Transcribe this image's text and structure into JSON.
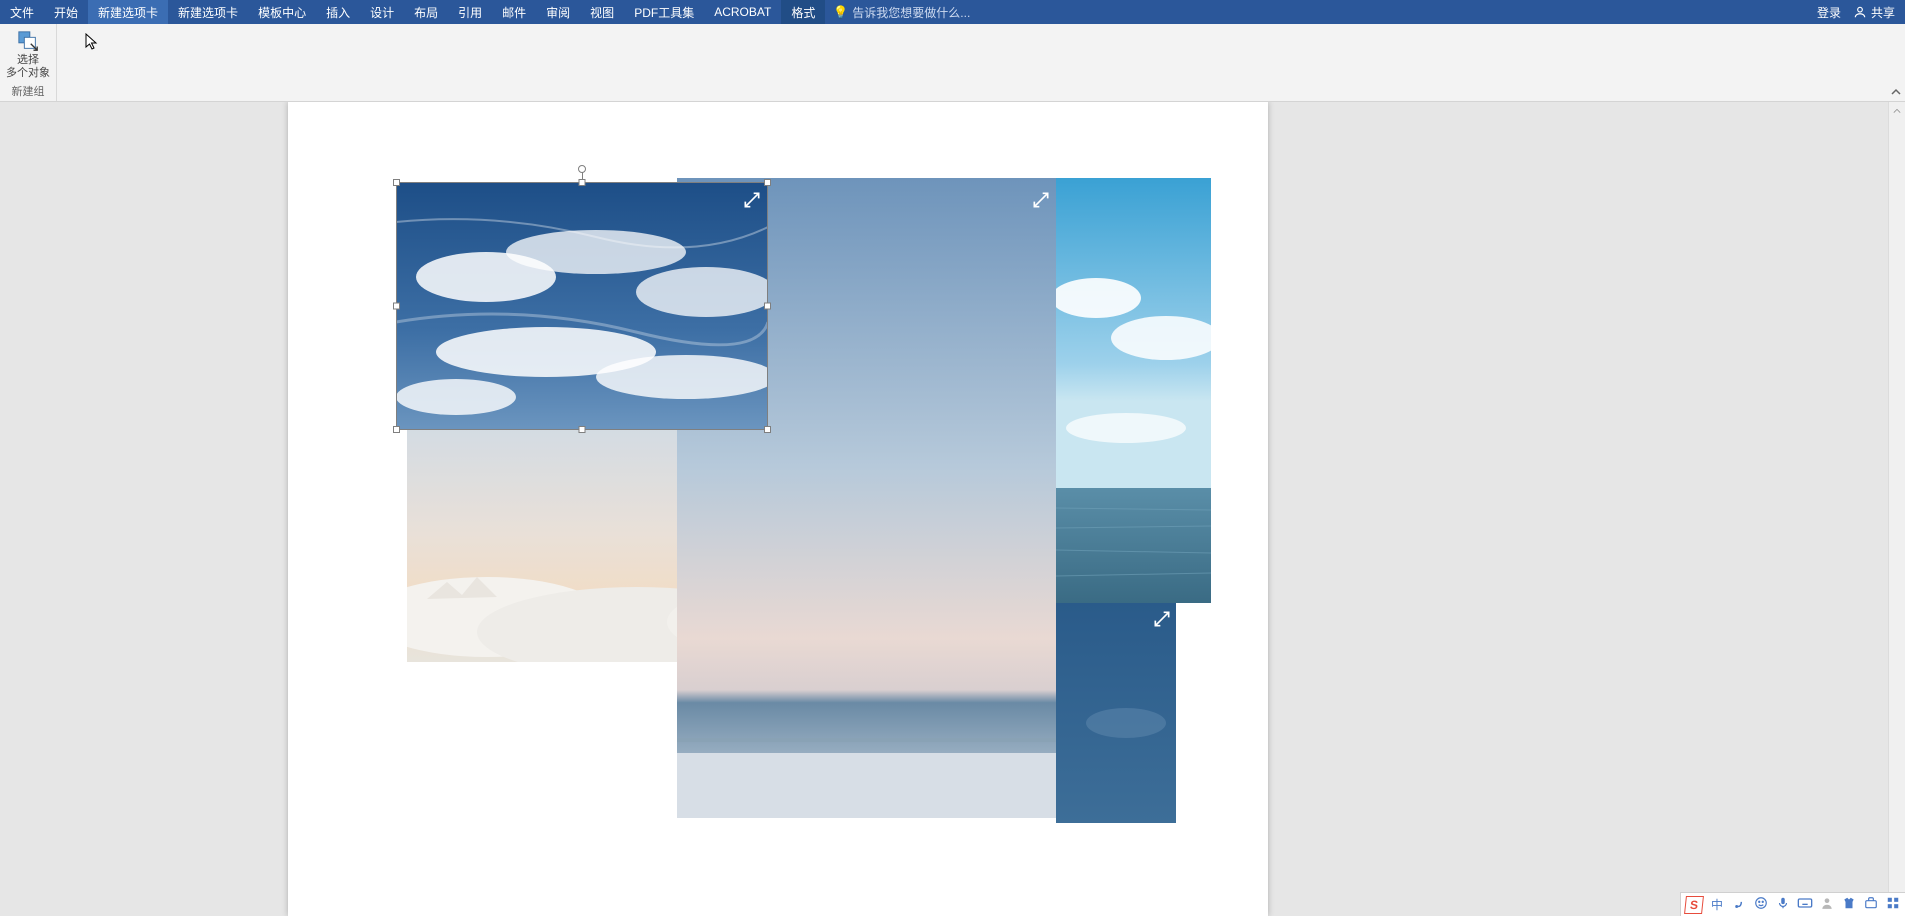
{
  "ribbon": {
    "tabs": [
      {
        "id": "file",
        "label": "文件"
      },
      {
        "id": "home",
        "label": "开始"
      },
      {
        "id": "newtab1",
        "label": "新建选项卡",
        "active": true
      },
      {
        "id": "newtab2",
        "label": "新建选项卡"
      },
      {
        "id": "templates",
        "label": "模板中心"
      },
      {
        "id": "insert",
        "label": "插入"
      },
      {
        "id": "design",
        "label": "设计"
      },
      {
        "id": "layout",
        "label": "布局"
      },
      {
        "id": "references",
        "label": "引用"
      },
      {
        "id": "mailings",
        "label": "邮件"
      },
      {
        "id": "review",
        "label": "审阅"
      },
      {
        "id": "view",
        "label": "视图"
      },
      {
        "id": "pdf",
        "label": "PDF工具集"
      },
      {
        "id": "acrobat",
        "label": "ACROBAT"
      },
      {
        "id": "format",
        "label": "格式",
        "contextual": true
      }
    ],
    "tell_me_placeholder": "告诉我您想要做什么...",
    "login_label": "登录",
    "share_label": "共享",
    "group": {
      "button_label_line1": "选择",
      "button_label_line2": "多个对象",
      "group_name": "新建组"
    }
  },
  "ime": {
    "lang": "中"
  }
}
